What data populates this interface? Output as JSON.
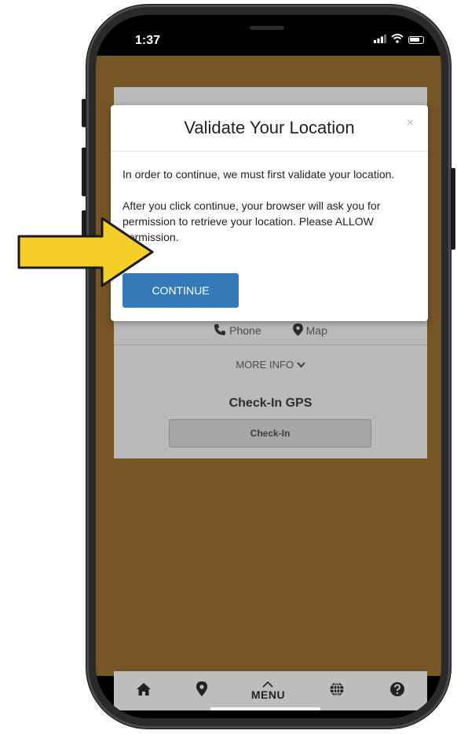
{
  "status_bar": {
    "time": "1:37"
  },
  "modal": {
    "title": "Validate Your Location",
    "close_label": "×",
    "paragraph1": "In order to continue, we must first validate your location.",
    "paragraph2": "After you click continue, your browser will ask you for permission to retrieve your location. Please ALLOW permission.",
    "continue_label": "CONTINUE"
  },
  "card": {
    "phone_label": "Phone",
    "map_label": "Map",
    "more_info_label": "MORE INFO",
    "checkin_title": "Check-In GPS",
    "checkin_button": "Check-In"
  },
  "bottom_nav": {
    "items": [
      {
        "icon": "home-icon"
      },
      {
        "icon": "location-pin-icon"
      },
      {
        "icon": "chevron-up-icon",
        "label": "MENU"
      },
      {
        "icon": "globe-icon"
      },
      {
        "icon": "question-circle-icon"
      }
    ]
  },
  "colors": {
    "page_background": "#84602c",
    "button_primary": "#337ab7",
    "arrow_fill": "#f4cf2a",
    "card_background": "#cfcfcf"
  }
}
